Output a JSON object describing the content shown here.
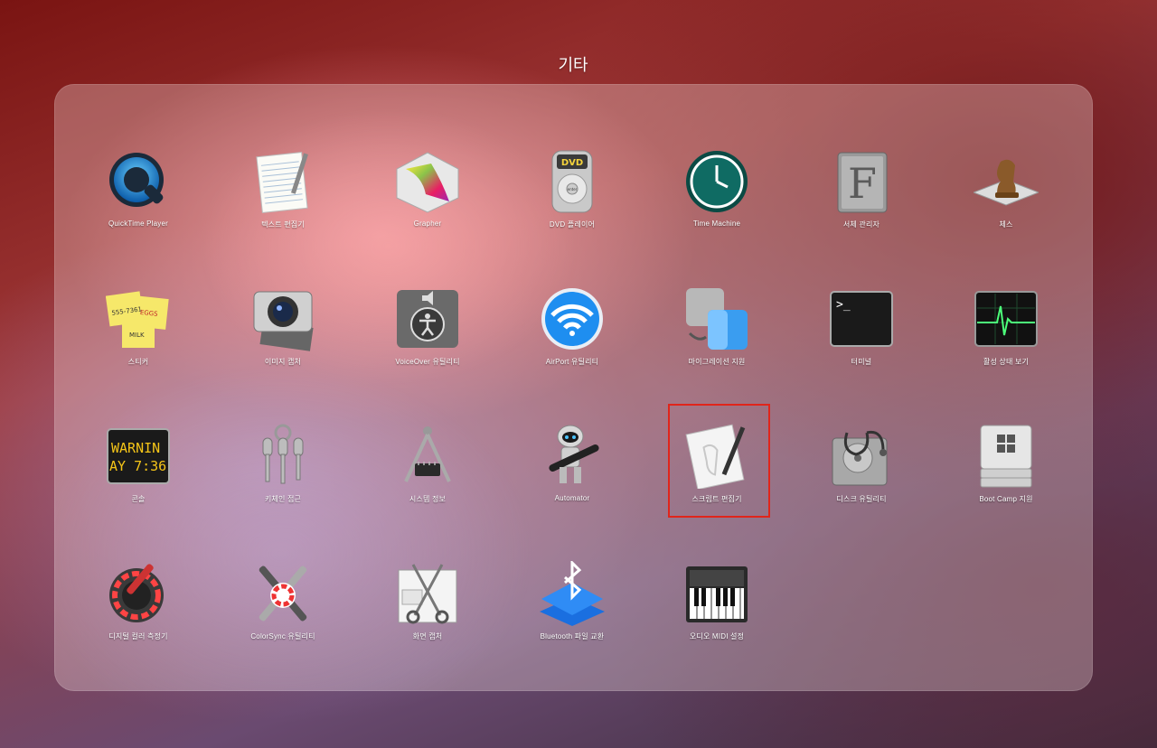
{
  "folder": {
    "title": "기타"
  },
  "apps": [
    {
      "label": "QuickTime Player",
      "icon": "quicktime-icon"
    },
    {
      "label": "텍스트 편집기",
      "icon": "textedit-icon"
    },
    {
      "label": "Grapher",
      "icon": "grapher-icon"
    },
    {
      "label": "DVD 플레이어",
      "icon": "dvd-player-icon"
    },
    {
      "label": "Time Machine",
      "icon": "time-machine-icon"
    },
    {
      "label": "서체 관리자",
      "icon": "font-book-icon"
    },
    {
      "label": "체스",
      "icon": "chess-icon"
    },
    {
      "label": "스티커",
      "icon": "stickies-icon"
    },
    {
      "label": "이미지 캡처",
      "icon": "image-capture-icon"
    },
    {
      "label": "VoiceOver 유틸리티",
      "icon": "voiceover-icon"
    },
    {
      "label": "AirPort 유틸리티",
      "icon": "airport-icon"
    },
    {
      "label": "마이그레이션 지원",
      "icon": "migration-icon"
    },
    {
      "label": "터미널",
      "icon": "terminal-icon"
    },
    {
      "label": "활성 상태 보기",
      "icon": "activity-monitor-icon"
    },
    {
      "label": "콘솔",
      "icon": "console-icon"
    },
    {
      "label": "키체인 접근",
      "icon": "keychain-icon"
    },
    {
      "label": "시스템 정보",
      "icon": "system-info-icon"
    },
    {
      "label": "Automator",
      "icon": "automator-icon"
    },
    {
      "label": "스크립트 편집기",
      "icon": "script-editor-icon",
      "selected": true
    },
    {
      "label": "디스크 유틸리티",
      "icon": "disk-utility-icon"
    },
    {
      "label": "Boot Camp 지원",
      "icon": "bootcamp-icon"
    },
    {
      "label": "디지털 컬러 측정기",
      "icon": "color-meter-icon"
    },
    {
      "label": "ColorSync 유틸리티",
      "icon": "colorsync-icon"
    },
    {
      "label": "화면 캡처",
      "icon": "screenshot-icon"
    },
    {
      "label": "Bluetooth 파일 교환",
      "icon": "bluetooth-icon"
    },
    {
      "label": "오디오 MIDI 설정",
      "icon": "midi-icon"
    }
  ],
  "icon_text": {
    "dvd": "DVD",
    "dvd_small": "VIDEO",
    "dvd_enter": "enter",
    "font_letter": "F",
    "terminal_prompt": ">_",
    "console_line1": "WARNIN",
    "console_line2": "AY 7:36",
    "sticky_line1": "555-7361",
    "sticky_line2": "EGGS",
    "sticky_line3": "MILK"
  }
}
